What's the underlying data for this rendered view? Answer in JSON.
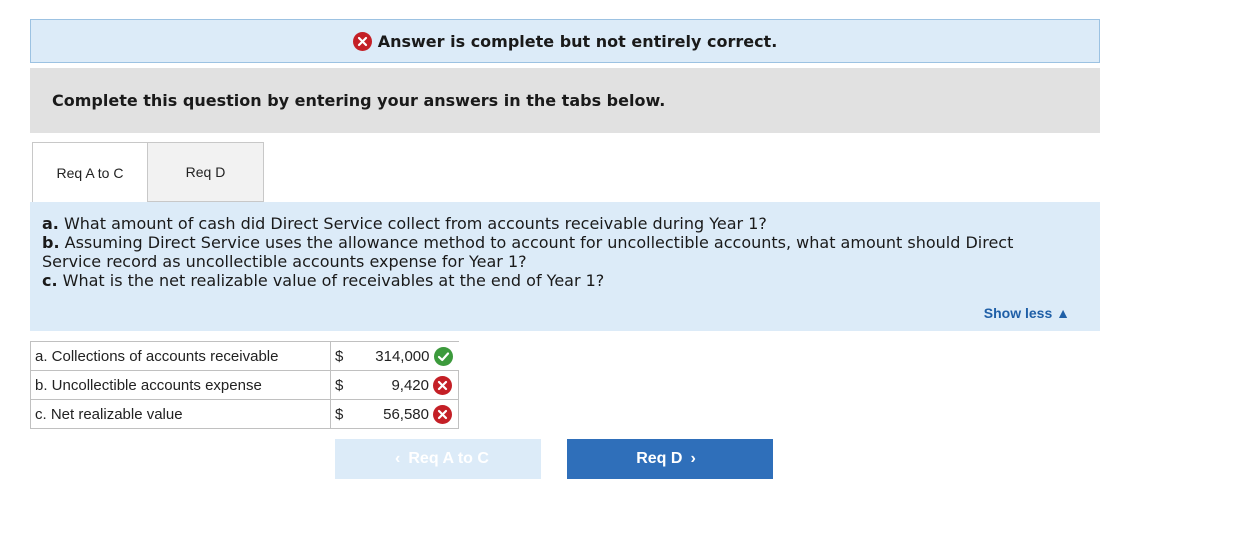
{
  "banner": {
    "message": "Answer is complete but not entirely correct.",
    "icon": "error-x-icon",
    "color": "#c41f26"
  },
  "instructions": "Complete this question by entering your answers in the tabs below.",
  "tabs": [
    {
      "label": "Req A to C",
      "active": true
    },
    {
      "label": "Req D",
      "active": false
    }
  ],
  "question": {
    "a_marker": "a.",
    "a_text": " What amount of cash did Direct Service collect from accounts receivable during Year 1?",
    "b_marker": "b.",
    "b_text_1": " Assuming Direct Service uses the allowance method to account for uncollectible accounts, what amount should Direct",
    "b_text_2": "Service record as uncollectible accounts expense for Year 1?",
    "c_marker": "c.",
    "c_text": " What is the net realizable value of receivables at the end of Year 1?",
    "show_less": "Show less"
  },
  "answers": [
    {
      "label": "a. Collections of accounts receivable",
      "currency": "$",
      "value": "314,000",
      "status": "correct"
    },
    {
      "label": "b. Uncollectible accounts expense",
      "currency": "$",
      "value": "9,420",
      "status": "incorrect"
    },
    {
      "label": "c. Net realizable value",
      "currency": "$",
      "value": "56,580",
      "status": "incorrect"
    }
  ],
  "nav": {
    "prev_label": "Req A to C",
    "next_label": "Req D"
  },
  "colors": {
    "correct": "#3c9a3c",
    "incorrect": "#c41f26",
    "accent": "#2f6fba"
  }
}
